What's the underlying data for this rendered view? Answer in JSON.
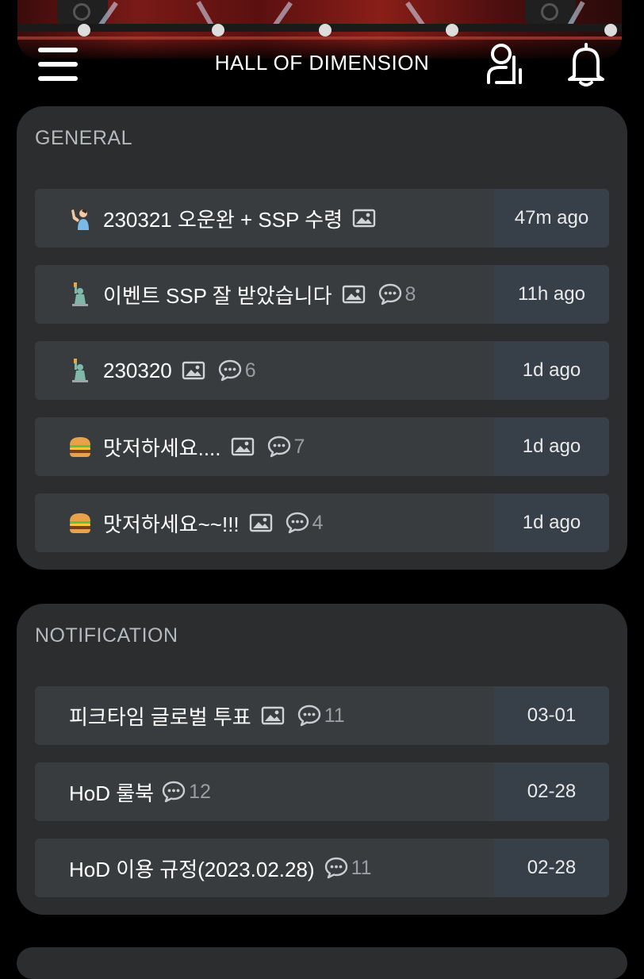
{
  "header": {
    "title": "HALL OF DIMENSION",
    "menu_icon": "hamburger-menu-icon",
    "user_icon": "user-profile-icon",
    "bell_icon": "notification-bell-icon",
    "banner": "stage-banner-image"
  },
  "general": {
    "heading": "GENERAL",
    "items": [
      {
        "emoji": "person-raising-hand",
        "title": "230321 오운완 + SSP 수령",
        "has_image": true,
        "comments": "",
        "time": "47m ago"
      },
      {
        "emoji": "statue-of-liberty",
        "title": "이벤트 SSP 잘 받았습니다",
        "has_image": true,
        "comments": "8",
        "time": "11h ago"
      },
      {
        "emoji": "statue-of-liberty",
        "title": "230320",
        "has_image": true,
        "comments": "6",
        "time": "1d ago"
      },
      {
        "emoji": "hamburger",
        "title": "맛저하세요....",
        "has_image": true,
        "comments": "7",
        "time": "1d ago"
      },
      {
        "emoji": "hamburger",
        "title": "맛저하세요~~!!!",
        "has_image": true,
        "comments": "4",
        "time": "1d ago"
      }
    ]
  },
  "notification": {
    "heading": "NOTIFICATION",
    "items": [
      {
        "title": "피크타임 글로벌 투표",
        "has_image": true,
        "comments": "11",
        "time": "03-01"
      },
      {
        "title": "HoD 룰북",
        "has_image": false,
        "comments": "12",
        "time": "02-28"
      },
      {
        "title": "HoD 이용 규정(2023.02.28)",
        "has_image": false,
        "comments": "11",
        "time": "02-28"
      }
    ]
  },
  "colors": {
    "background": "#000000",
    "card": "#2b2d2f",
    "row": "#393c3e",
    "time_cell": "#374049",
    "muted_text": "#9a9ea2"
  }
}
